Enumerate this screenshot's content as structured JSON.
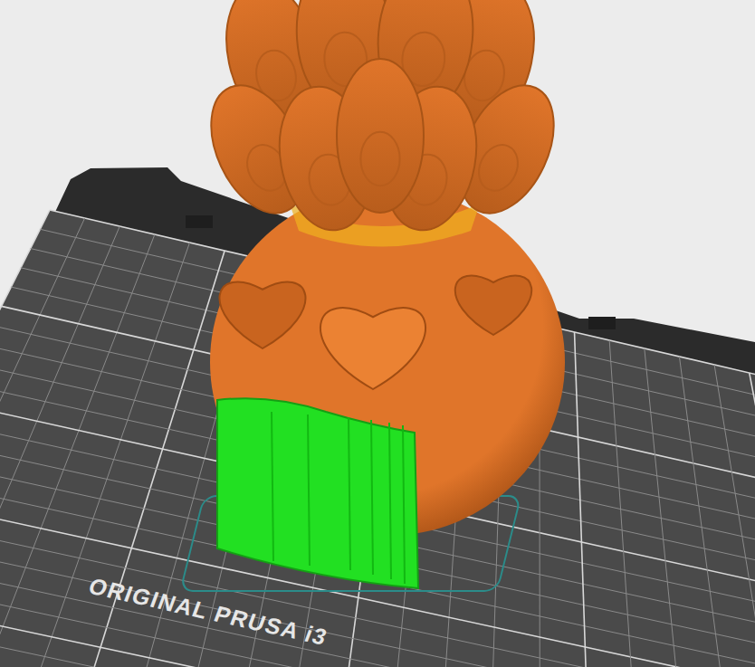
{
  "bed": {
    "label": "ORIGINAL PRUSA i3"
  },
  "parts": [
    {
      "kind": "model",
      "color": "#e0752a"
    },
    {
      "kind": "support",
      "color": "#22e022"
    }
  ]
}
